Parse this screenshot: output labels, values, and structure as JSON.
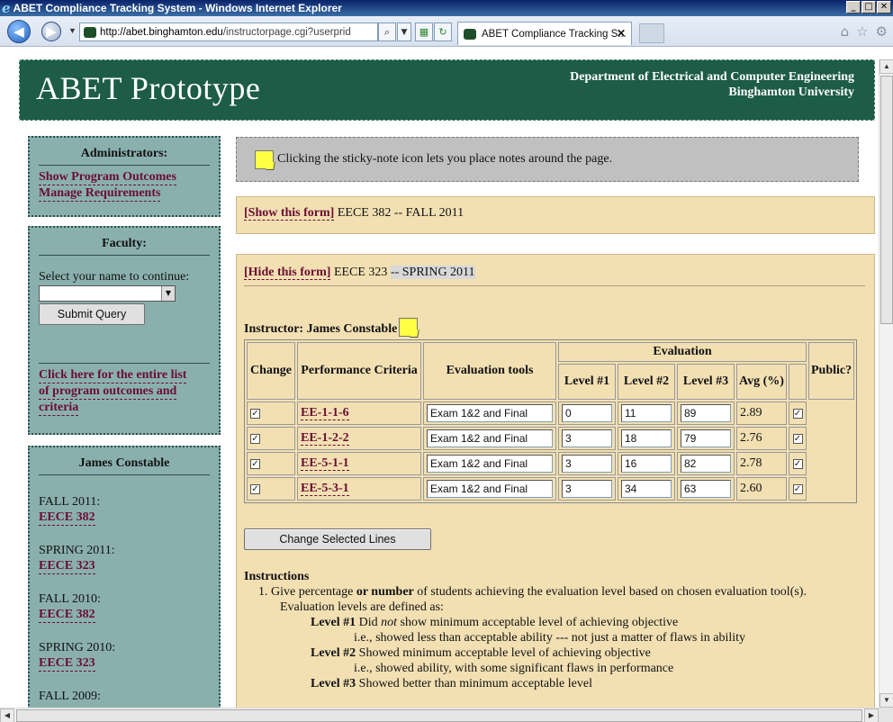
{
  "browser": {
    "window_title": "ABET Compliance Tracking System - Windows Internet Explorer",
    "url_domain": "http://abet.binghamton.edu",
    "url_path": "/instructorpage.cgi?userprid",
    "tab_title": "ABET Compliance Tracking S...",
    "tab_close": "✕",
    "icons": [
      "back-arrow-icon",
      "forward-arrow-icon",
      "home-icon",
      "favorites-star-icon",
      "tools-gear-icon",
      "search-icon",
      "refresh-icon",
      "stop-icon",
      "compat-icon"
    ]
  },
  "banner": {
    "title": "ABET Prototype",
    "dept_line1": "Department of Electrical and Computer Engineering",
    "dept_line2": "Binghamton University"
  },
  "admin": {
    "heading": "Administrators:",
    "links": [
      "Show Program Outcomes",
      "Manage Requirements"
    ]
  },
  "faculty": {
    "heading": "Faculty:",
    "select_label": "Select your name to continue:",
    "select_value": "",
    "submit": "Submit Query",
    "list_link_line1": "Click here for the entire list",
    "list_link_line2": "of program outcomes and",
    "list_link_line3": "criteria"
  },
  "instructor_box": {
    "heading": "James Constable",
    "terms": [
      {
        "term": "FALL 2011:",
        "course": "EECE 382"
      },
      {
        "term": "SPRING 2011:",
        "course": "EECE 323"
      },
      {
        "term": "FALL 2010:",
        "course": "EECE 382"
      },
      {
        "term": "SPRING 2010:",
        "course": "EECE 323"
      },
      {
        "term": "FALL 2009:",
        "course": ""
      }
    ]
  },
  "notice": {
    "text": "Clicking the sticky-note icon lets you place notes around the page."
  },
  "form1": {
    "toggle": "[Show this form]",
    "course": "EECE 382 -- FALL 2011"
  },
  "form2": {
    "toggle": "[Hide this form]",
    "course_prefix": "EECE 323",
    "course_suffix": "-- SPRING 2011",
    "instructor_label": "Instructor: James Constable",
    "headers": {
      "change": "Change",
      "criteria": "Performance Criteria",
      "tools": "Evaluation tools",
      "evaluation": "Evaluation",
      "level1": "Level #1",
      "level2": "Level #2",
      "level3": "Level #3",
      "avg": "Avg (%)",
      "public": "Public?"
    },
    "rows": [
      {
        "checked": "✓",
        "criteria": "EE-1-1-6",
        "tool": "Exam 1&2 and Final",
        "l1": "0",
        "l2": "11",
        "l3": "89",
        "avg": "2.89",
        "public": "✓"
      },
      {
        "checked": "✓",
        "criteria": "EE-1-2-2",
        "tool": "Exam 1&2 and Final",
        "l1": "3",
        "l2": "18",
        "l3": "79",
        "avg": "2.76",
        "public": "✓"
      },
      {
        "checked": "✓",
        "criteria": "EE-5-1-1",
        "tool": "Exam 1&2 and Final",
        "l1": "3",
        "l2": "16",
        "l3": "82",
        "avg": "2.78",
        "public": "✓"
      },
      {
        "checked": "✓",
        "criteria": "EE-5-3-1",
        "tool": "Exam 1&2 and Final",
        "l1": "3",
        "l2": "34",
        "l3": "63",
        "avg": "2.60",
        "public": "✓"
      }
    ],
    "change_button": "Change Selected Lines"
  },
  "instructions": {
    "heading": "Instructions",
    "item1_a": "1.  Give percentage ",
    "item1_b": "or number",
    "item1_c": " of students achieving the evaluation level based on chosen evaluation tool(s).",
    "item1_line2": "Evaluation levels are defined as:",
    "level1_label": "Level #1",
    "level1_a": " Did ",
    "level1_not": "not",
    "level1_b": " show minimum acceptable level of achieving objective",
    "level1_ie": "i.e., showed less than acceptable ability --- not just a matter of flaws in ability",
    "level2_label": "Level #2",
    "level2_text": " Showed minimum acceptable level of achieving objective",
    "level2_ie": "i.e., showed ability, with some significant flaws in performance",
    "level3_label": "Level #3",
    "level3_text": " Showed better than minimum acceptable level"
  }
}
